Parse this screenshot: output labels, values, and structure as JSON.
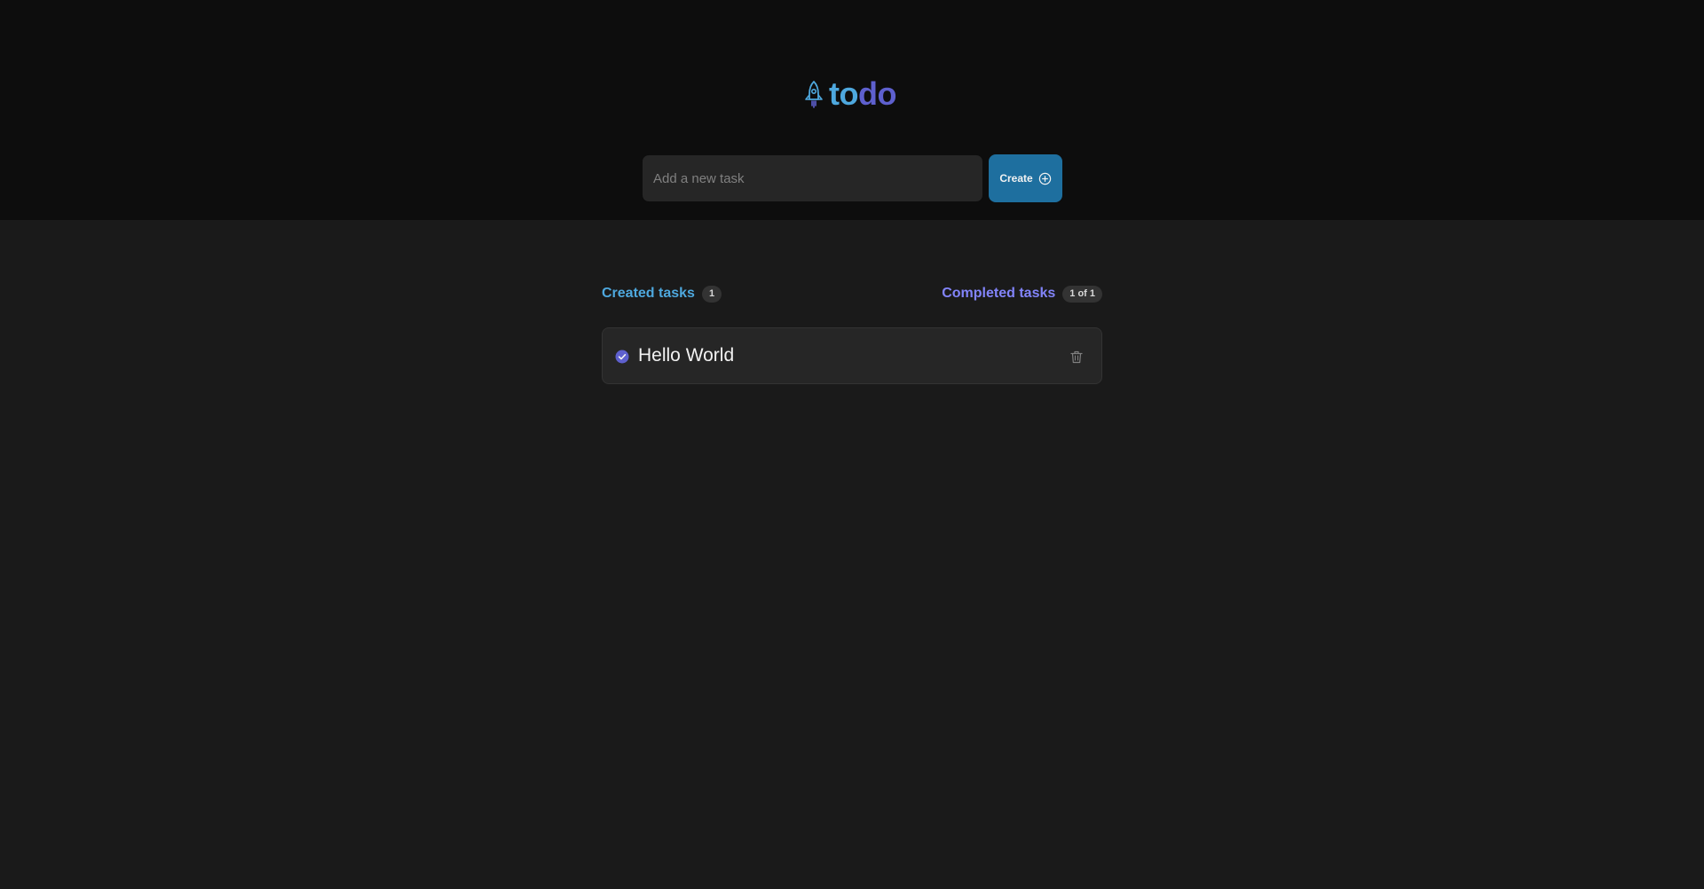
{
  "header": {
    "logo": {
      "icon": "rocket-icon",
      "word_part1": "to",
      "word_part2": "do",
      "color_part1": "#4ea8de",
      "color_part2": "#5e60ce"
    },
    "input": {
      "placeholder": "Add a new task",
      "value": ""
    },
    "create_button": {
      "label": "Create",
      "icon": "plus-circle-icon",
      "color": "#1e6f9f"
    }
  },
  "stats": {
    "created": {
      "label": "Created tasks",
      "count": "1",
      "color": "#4ea8de"
    },
    "completed": {
      "label": "Completed tasks",
      "count": "1 of 1",
      "color": "#8284fa"
    }
  },
  "tasks": [
    {
      "text": "Hello World",
      "completed": true,
      "check_icon": "check-circle-icon",
      "delete_icon": "trash-icon"
    }
  ]
}
